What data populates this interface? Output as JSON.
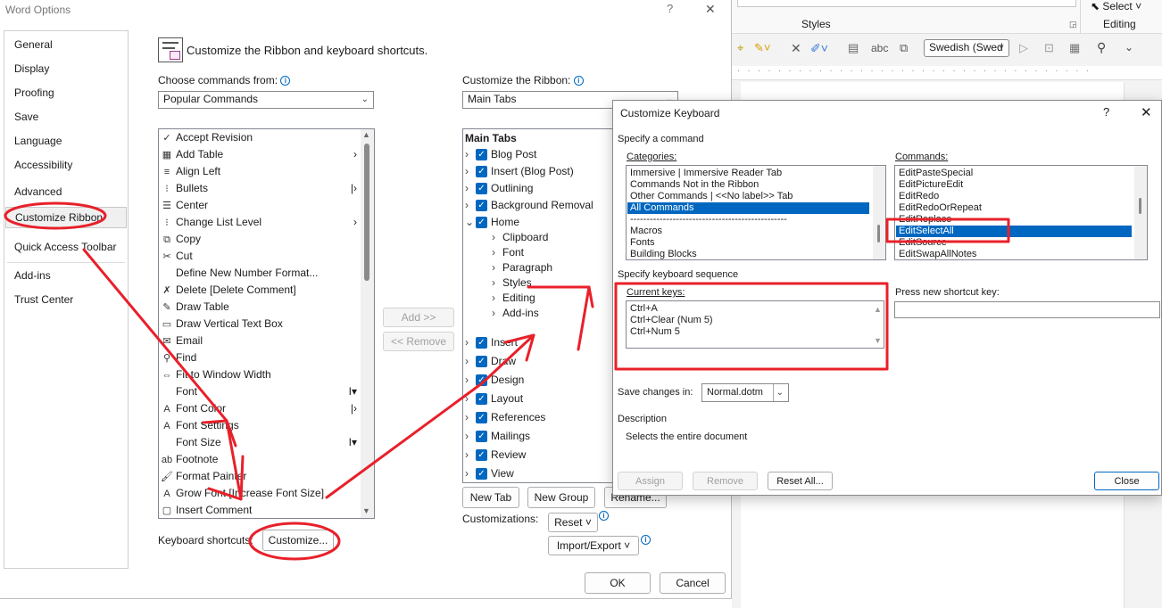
{
  "bg_word": {
    "styles_label": "Styles",
    "select_label": "Select",
    "editing_label": "Editing",
    "language_value": "Swedish (Swed"
  },
  "word_options": {
    "title": "Word Options",
    "help": "?",
    "close": "✕",
    "nav": [
      "General",
      "Display",
      "Proofing",
      "Save",
      "Language",
      "Accessibility",
      "Advanced",
      "Customize Ribbon",
      "Quick Access Toolbar",
      "Add-ins",
      "Trust Center"
    ],
    "heading": "Customize the Ribbon and keyboard shortcuts.",
    "choose_label": "Choose commands from:",
    "choose_value": "Popular Commands",
    "ribbon_label": "Customize the Ribbon:",
    "ribbon_value": "Main Tabs",
    "commands": [
      {
        "icon": "accept-icon",
        "label": "Accept Revision",
        "arrow": ""
      },
      {
        "icon": "table-icon",
        "label": "Add Table",
        "arrow": "›"
      },
      {
        "icon": "align-left-icon",
        "label": "Align Left",
        "arrow": ""
      },
      {
        "icon": "bullets-icon",
        "label": "Bullets",
        "arrow": "|›"
      },
      {
        "icon": "center-icon",
        "label": "Center",
        "arrow": ""
      },
      {
        "icon": "list-level-icon",
        "label": "Change List Level",
        "arrow": "›"
      },
      {
        "icon": "copy-icon",
        "label": "Copy",
        "arrow": ""
      },
      {
        "icon": "cut-icon",
        "label": "Cut",
        "arrow": ""
      },
      {
        "icon": "",
        "label": "Define New Number Format...",
        "arrow": ""
      },
      {
        "icon": "delete-comment-icon",
        "label": "Delete [Delete Comment]",
        "arrow": ""
      },
      {
        "icon": "draw-table-icon",
        "label": "Draw Table",
        "arrow": ""
      },
      {
        "icon": "text-box-icon",
        "label": "Draw Vertical Text Box",
        "arrow": ""
      },
      {
        "icon": "email-icon",
        "label": "Email",
        "arrow": ""
      },
      {
        "icon": "find-icon",
        "label": "Find",
        "arrow": ""
      },
      {
        "icon": "fit-width-icon",
        "label": "Fit to Window Width",
        "arrow": ""
      },
      {
        "icon": "",
        "label": "Font",
        "arrow": "I▾"
      },
      {
        "icon": "font-color-icon",
        "label": "Font Color",
        "arrow": "|›"
      },
      {
        "icon": "font-settings-icon",
        "label": "Font Settings",
        "arrow": ""
      },
      {
        "icon": "",
        "label": "Font Size",
        "arrow": "I▾"
      },
      {
        "icon": "footnote-icon",
        "label": "Footnote",
        "arrow": ""
      },
      {
        "icon": "format-painter-icon",
        "label": "Format Painter",
        "arrow": ""
      },
      {
        "icon": "grow-font-icon",
        "label": "Grow Font [Increase Font Size]",
        "arrow": ""
      },
      {
        "icon": "insert-comment-icon",
        "label": "Insert Comment",
        "arrow": ""
      }
    ],
    "add_btn": "Add >>",
    "remove_btn": "<< Remove",
    "tree_header": "Main Tabs",
    "tree": [
      {
        "label": "Blog Post",
        "level": 0,
        "check": true,
        "expand": "›"
      },
      {
        "label": "Insert (Blog Post)",
        "level": 0,
        "check": true,
        "expand": "›"
      },
      {
        "label": "Outlining",
        "level": 0,
        "check": true,
        "expand": "›"
      },
      {
        "label": "Background Removal",
        "level": 0,
        "check": true,
        "expand": "›"
      },
      {
        "label": "Home",
        "level": 0,
        "check": true,
        "expand": "⌄"
      },
      {
        "label": "Clipboard",
        "level": 1,
        "check": false,
        "expand": "›"
      },
      {
        "label": "Font",
        "level": 1,
        "check": false,
        "expand": "›"
      },
      {
        "label": "Paragraph",
        "level": 1,
        "check": false,
        "expand": "›"
      },
      {
        "label": "Styles",
        "level": 1,
        "check": false,
        "expand": "›"
      },
      {
        "label": "Editing",
        "level": 1,
        "check": false,
        "expand": "›"
      },
      {
        "label": "Add-ins",
        "level": 1,
        "check": false,
        "expand": "›"
      },
      {
        "label": "Insert",
        "level": 0,
        "check": true,
        "expand": "›"
      },
      {
        "label": "Draw",
        "level": 0,
        "check": true,
        "expand": "›"
      },
      {
        "label": "Design",
        "level": 0,
        "check": true,
        "expand": "›"
      },
      {
        "label": "Layout",
        "level": 0,
        "check": true,
        "expand": "›"
      },
      {
        "label": "References",
        "level": 0,
        "check": true,
        "expand": "›"
      },
      {
        "label": "Mailings",
        "level": 0,
        "check": true,
        "expand": "›"
      },
      {
        "label": "Review",
        "level": 0,
        "check": true,
        "expand": "›"
      },
      {
        "label": "View",
        "level": 0,
        "check": true,
        "expand": "›"
      }
    ],
    "new_tab": "New Tab",
    "new_group": "New Group",
    "rename": "Rename...",
    "customizations_label": "Customizations:",
    "reset_btn": "Reset ˅",
    "import_export_btn": "Import/Export ˅",
    "kb_label": "Keyboard shortcuts:",
    "customize_btn": "Customize...",
    "ok": "OK",
    "cancel": "Cancel"
  },
  "customize_keyboard": {
    "title": "Customize Keyboard",
    "help": "?",
    "close": "✕",
    "specify_command": "Specify a command",
    "categories_label": "Categories:",
    "categories": [
      "Immersive | Immersive Reader Tab",
      "Commands Not in the Ribbon",
      "Other Commands | <<No label>> Tab",
      "All Commands",
      "------------------------------------------------",
      "Macros",
      "Fonts",
      "Building Blocks"
    ],
    "commands_label": "Commands:",
    "commands": [
      "EditPasteSpecial",
      "EditPictureEdit",
      "EditRedo",
      "EditRedoOrRepeat",
      "EditReplace",
      "EditSelectAll",
      "EditSource",
      "EditSwapAllNotes"
    ],
    "specify_sequence": "Specify keyboard sequence",
    "current_keys_label": "Current keys:",
    "current_keys": [
      "Ctrl+A",
      "Ctrl+Clear (Num 5)",
      "Ctrl+Num 5"
    ],
    "press_new_label": "Press new shortcut key:",
    "save_in_label": "Save changes in:",
    "save_in_value": "Normal.dotm",
    "description_label": "Description",
    "description": "Selects the entire document",
    "assign": "Assign",
    "remove": "Remove",
    "reset_all": "Reset All...",
    "close_btn": "Close"
  },
  "colors": {
    "accent": "#0067c0",
    "annotation": "#e8202a"
  }
}
